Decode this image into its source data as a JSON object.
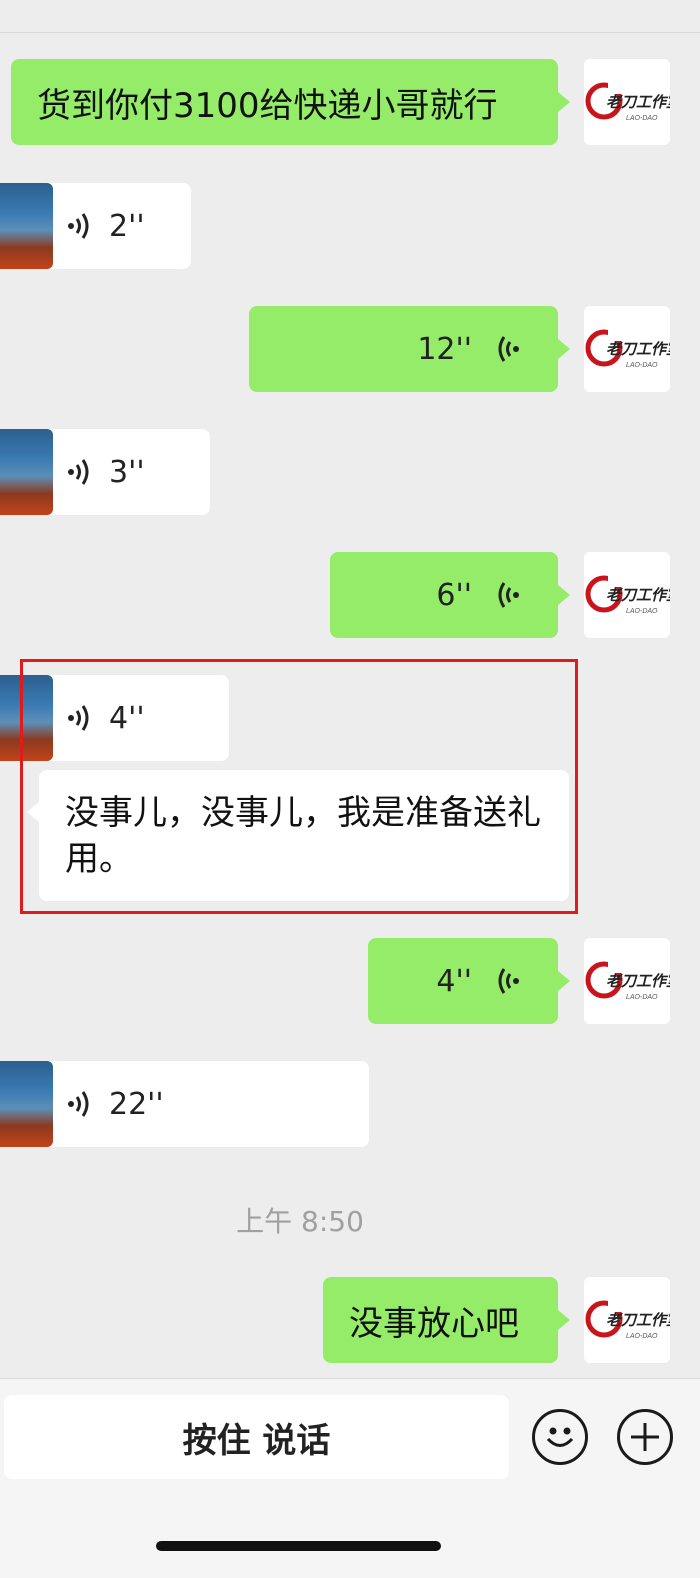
{
  "messages": [
    {
      "side": "me",
      "type": "text",
      "text": "货到你付3100给快递小哥就行"
    },
    {
      "side": "other",
      "type": "voice",
      "duration": "2''"
    },
    {
      "side": "me",
      "type": "voice",
      "duration": "12''"
    },
    {
      "side": "other",
      "type": "voice",
      "duration": "3''"
    },
    {
      "side": "me",
      "type": "voice",
      "duration": "6''"
    },
    {
      "side": "other",
      "type": "voice",
      "duration": "4''"
    },
    {
      "side": "other",
      "type": "text",
      "text": "没事儿，没事儿，我是准备送礼用。"
    },
    {
      "side": "me",
      "type": "voice",
      "duration": "4''"
    },
    {
      "side": "other",
      "type": "voice",
      "duration": "22''"
    },
    {
      "side": "me",
      "type": "text",
      "text": "没事放心吧"
    }
  ],
  "timestamp": "上午 8:50",
  "my_avatar": {
    "title": "老刀工作室",
    "subtitle": "LAO-DAO"
  },
  "input_bar": {
    "hold_to_talk": "按住 说话"
  },
  "icons": {
    "emoji": "emoji-icon",
    "plus": "plus-icon",
    "voice": "voice-wave-icon"
  },
  "colors": {
    "my_bubble": "#95ec69",
    "other_bubble": "#ffffff",
    "highlight": "#e01b1b",
    "background": "#ededed"
  }
}
